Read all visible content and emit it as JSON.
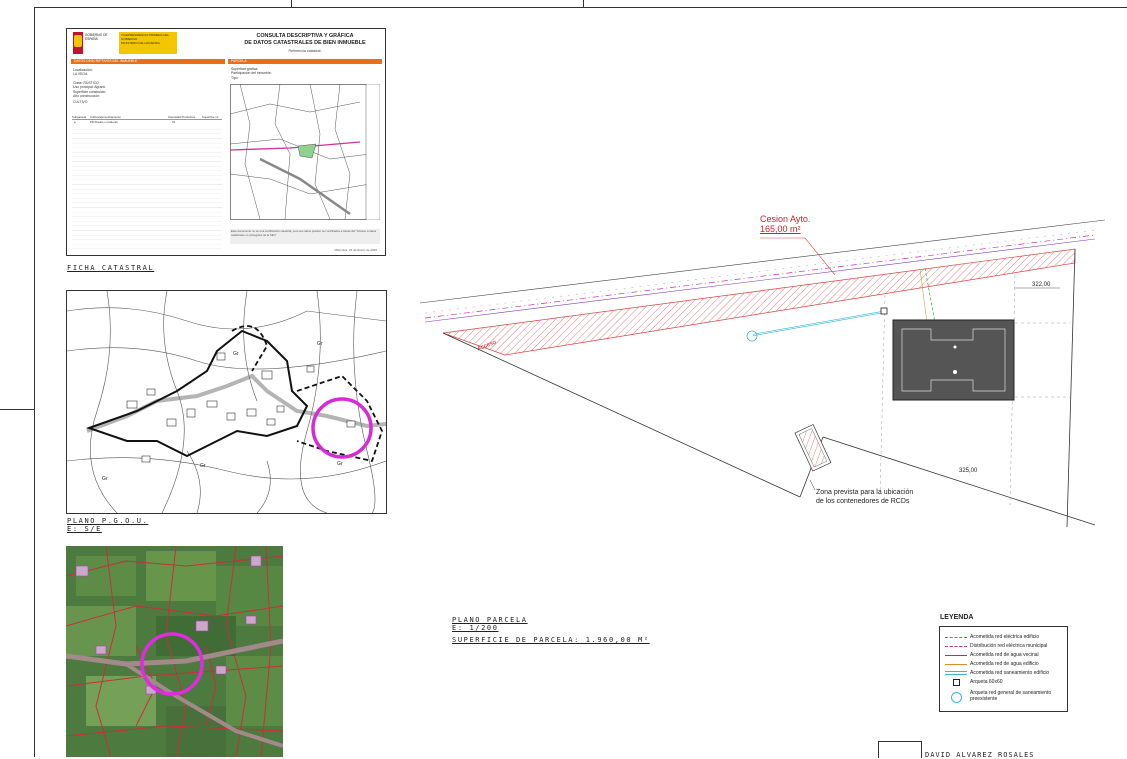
{
  "ficha": {
    "caption": "FICHA CATASTRAL",
    "title_line1": "CONSULTA DESCRIPTIVA Y GRÁFICA",
    "title_line2": "DE DATOS CATASTRALES DE BIEN INMUEBLE",
    "ref_label": "Referencia catastral:",
    "gob_text": "GOBIERNO DE ESPAÑA",
    "min_text": "VICEPRESIDENCIA PRIMERA DEL GOBIERNO",
    "min_text2": "MINISTERIO DE HACIENDA",
    "sec_bar_left": "DATOS DESCRIPTIVOS DEL INMUEBLE",
    "sec_bar_right": "PARCELA",
    "localizacion_label": "Localización:",
    "localizacion_value": "LA VEGA",
    "clase_label": "Clase: RÚSTICO",
    "uso_label": "Uso principal: Agrario",
    "superficie_label": "Superficie construida:",
    "anio_label": "Año construcción:",
    "cultivo_label": "CULTIVO",
    "sup_grafica": "Superficie gráfica:",
    "participacion": "Participación del inmueble:",
    "tipo": "Tipo:",
    "tbl_headers": [
      "Subparcela",
      "Cultivo/aprovechamiento",
      "Intensidad Productiva",
      "Superficie m²"
    ],
    "tbl_row": [
      "a",
      "PR Prados o praderas",
      "01",
      ""
    ],
    "note": "Este documento no es una certificación catastral, pero sus datos pueden ser verificados a través del \"Acceso a datos catastrales no protegidos de la SEC\"",
    "date": "Miércoles, 21 de Enero de 2026"
  },
  "pgou": {
    "caption_line1": "PLANO P.G.O.U.",
    "caption_line2": "E: S/E",
    "zone_labels": [
      "Gr",
      "Gr",
      "Gr",
      "Gr",
      "Gr"
    ]
  },
  "plan": {
    "cesion_label_line1": "Cesion Ayto.",
    "cesion_label_line2": "165,00 m²",
    "acceso_label": "Acceso",
    "elev_top": "322,00",
    "elev_bottom": "325,00",
    "rcd_line1": "Zona prevista para la ubicación",
    "rcd_line2": "de los contenedores de RCDs",
    "caption_line1": "PLANO PARCELA",
    "caption_line2": "E: 1/200",
    "caption_line3": "SUPERFICIE DE PARCELA:   1.960,00 M²"
  },
  "leyenda": {
    "title": "LEYENDA",
    "items": [
      {
        "label": "Acometida red eléctrica edificio",
        "color": "#3aa83a",
        "style": "dashed"
      },
      {
        "label": "Distribución red eléctrica municipal",
        "color": "#cc3366",
        "style": "dashdot"
      },
      {
        "label": "Acometida red de agua vecinal",
        "color": "#7a3fbf",
        "style": "solid"
      },
      {
        "label": "Acometida red de agua edificio",
        "color": "#e08a2a",
        "style": "solid"
      },
      {
        "label": "Acometida red saneamiento edificio",
        "color": "#38b8d8",
        "style": "double"
      },
      {
        "label": "Arqueta 60x60",
        "color": "#222222",
        "style": "square"
      },
      {
        "label": "Arqueta red general de saneamiento",
        "color": "#38b8d8",
        "style": "circle"
      },
      {
        "label": "preexistente",
        "color": "#38b8d8",
        "style": "none"
      }
    ]
  },
  "signature": {
    "name_partial": "DAVID ALVAREZ ROSALES"
  }
}
